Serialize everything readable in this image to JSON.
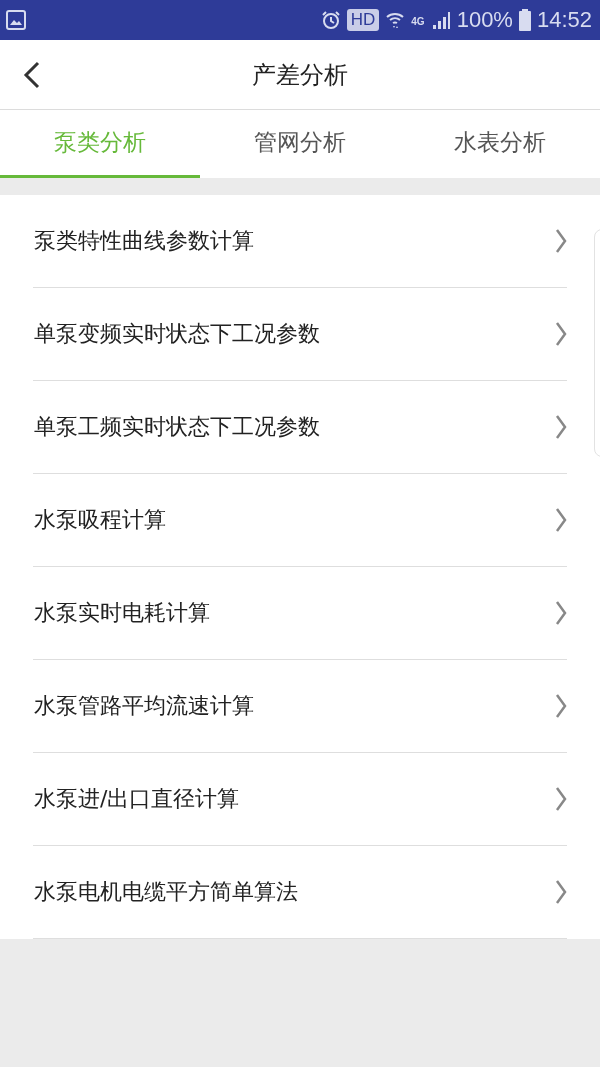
{
  "status_bar": {
    "hd": "HD",
    "network": "4G",
    "battery": "100%",
    "time": "14:52"
  },
  "header": {
    "title": "产差分析"
  },
  "tabs": [
    {
      "label": "泵类分析",
      "selected": true
    },
    {
      "label": "管网分析",
      "selected": false
    },
    {
      "label": "水表分析",
      "selected": false
    }
  ],
  "items": [
    {
      "label": "泵类特性曲线参数计算"
    },
    {
      "label": "单泵变频实时状态下工况参数"
    },
    {
      "label": "单泵工频实时状态下工况参数"
    },
    {
      "label": "水泵吸程计算"
    },
    {
      "label": "水泵实时电耗计算"
    },
    {
      "label": "水泵管路平均流速计算"
    },
    {
      "label": "水泵进/出口直径计算"
    },
    {
      "label": "水泵电机电缆平方简单算法"
    }
  ]
}
